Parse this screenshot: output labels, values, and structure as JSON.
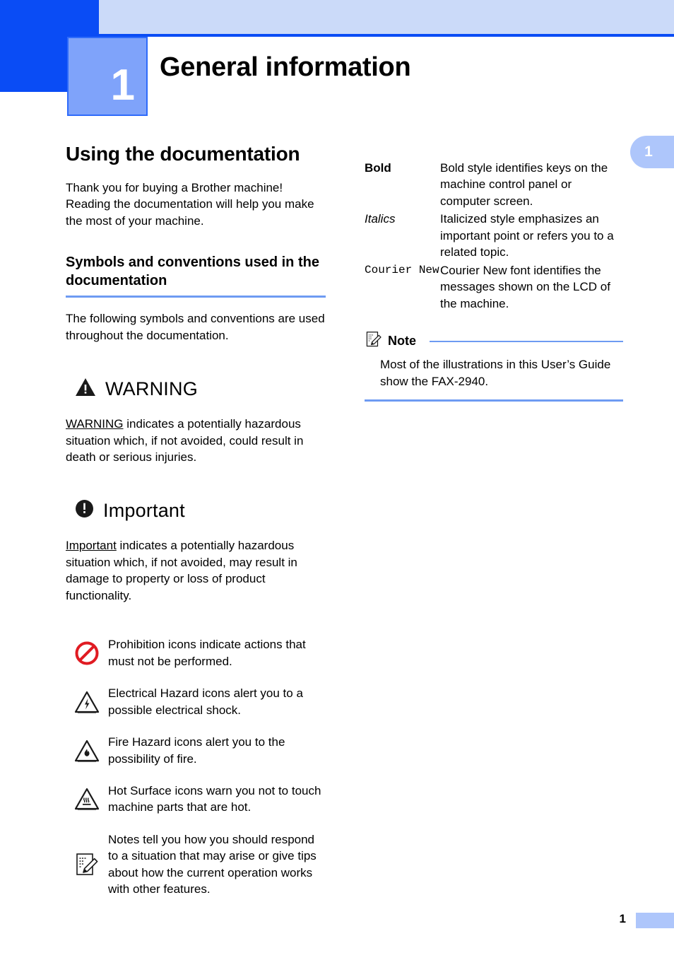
{
  "header": {
    "chapter_number": "1",
    "chapter_title": "General information",
    "edge_tab_number": "1"
  },
  "left_column": {
    "section_title": "Using the documentation",
    "intro_paragraph": "Thank you for buying a Brother machine! Reading the documentation will help you make the most of your machine.",
    "subsection_title": "Symbols and conventions used in the documentation",
    "subsection_paragraph": "The following symbols and conventions are used throughout the documentation.",
    "warning": {
      "icon": "warning-triangle-icon",
      "label": "WARNING",
      "lead_word": "WARNING",
      "body": " indicates a potentially hazardous situation which, if not avoided, could result in death or serious injuries."
    },
    "important": {
      "icon": "important-circle-icon",
      "label": "Important",
      "lead_word": "Important",
      "body": " indicates a potentially hazardous situation which, if not avoided, may result in damage to property or loss of product functionality."
    },
    "icon_rows": [
      {
        "icon": "prohibition-icon",
        "text": "Prohibition icons indicate actions that must not be performed."
      },
      {
        "icon": "electrical-hazard-icon",
        "text": "Electrical Hazard icons alert you to a possible electrical shock."
      },
      {
        "icon": "fire-hazard-icon",
        "text": "Fire Hazard icons alert you to the possibility of fire."
      },
      {
        "icon": "hot-surface-icon",
        "text": "Hot Surface icons warn you not to touch machine parts that are hot."
      },
      {
        "icon": "note-icon",
        "text": "Notes tell you how you should respond to a situation that may arise or give tips about how the current operation works with other features."
      }
    ]
  },
  "right_column": {
    "style_rows": [
      {
        "key": "Bold",
        "style": "bold",
        "description": "Bold style identifies keys on the machine control panel or computer screen."
      },
      {
        "key": "Italics",
        "style": "italic",
        "description": "Italicized style emphasizes an important point or refers you to a related topic."
      },
      {
        "key": "Courier New",
        "style": "courier",
        "description": "Courier New font identifies the messages shown on the LCD of the machine."
      }
    ],
    "note": {
      "icon": "note-icon",
      "title": "Note",
      "body": "Most of the illustrations in this User’s Guide show the FAX-2940."
    }
  },
  "footer": {
    "page_number": "1"
  },
  "colors": {
    "accent_dark_blue": "#0A4CF5",
    "banner_light_blue": "#CBDAF9",
    "chapter_box_blue": "#7FA3FA",
    "rule_blue": "#6E9BF2",
    "tab_blue": "#AEC6FB",
    "prohibition_red": "#E01B22"
  }
}
